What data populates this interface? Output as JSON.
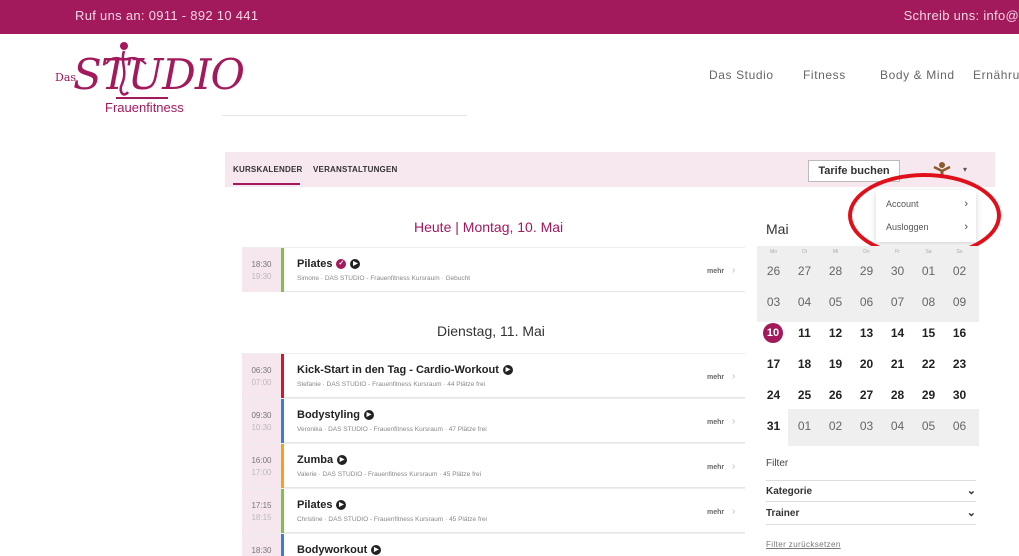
{
  "topbar": {
    "phone": "Ruf uns an: 0911 - 892 10 441",
    "email": "Schreib uns: info@",
    "bg_color": "#a2195c"
  },
  "logo": {
    "das": "Das",
    "studio": "STUDIO",
    "subtitle": "Frauenfitness"
  },
  "nav": {
    "items": [
      "Das Studio",
      "Fitness",
      "Body & Mind",
      "Ernähru"
    ]
  },
  "tabs": {
    "kurskalender": "KURSKALENDER",
    "veranstaltungen": "VERANSTALTUNGEN",
    "tarife_button": "Tarife buchen",
    "avatar_icon": "user-avatar-icon"
  },
  "user_menu": {
    "items": [
      {
        "label": "Account"
      },
      {
        "label": "Ausloggen"
      }
    ]
  },
  "days": [
    {
      "prefix": "Heute",
      "separator": "|",
      "label": "Montag, 10. Mai"
    },
    {
      "label": "Dienstag, 11. Mai"
    }
  ],
  "courses": [
    {
      "start": "18:30",
      "end": "19:30",
      "name": "Pilates",
      "info": "Simone · DAS STUDIO - Frauenfitness Kursraum · Gebucht",
      "color": "#7cc243",
      "booked": true,
      "more": "mehr"
    },
    {
      "start": "06:30",
      "end": "07:00",
      "name": "Kick-Start in den Tag - Cardio-Workout",
      "info": "Stefanie · DAS STUDIO - Frauenfitness Kursraum · 44 Plätze frei",
      "color": "#d8142a",
      "booked": false,
      "more": "mehr"
    },
    {
      "start": "09:30",
      "end": "10:30",
      "name": "Bodystyling",
      "info": "Veronika · DAS STUDIO - Frauenfitness Kursraum · 47 Plätze frei",
      "color": "#3b7dd8",
      "booked": false,
      "more": "mehr"
    },
    {
      "start": "16:00",
      "end": "17:00",
      "name": "Zumba",
      "info": "Valerie · DAS STUDIO - Frauenfitness Kursraum · 45 Plätze frei",
      "color": "#f4a21b",
      "booked": false,
      "more": "mehr"
    },
    {
      "start": "17:15",
      "end": "18:15",
      "name": "Pilates",
      "info": "Christine · DAS STUDIO - Frauenfitness Kursraum · 45 Plätze frei",
      "color": "#7cc243",
      "booked": false,
      "more": "mehr"
    },
    {
      "start": "18:30",
      "end": "",
      "name": "Bodyworkout",
      "info": "",
      "color": "#3b7dd8",
      "booked": false,
      "more": ""
    }
  ],
  "calendar": {
    "month": "Mai",
    "weekdays": [
      "Mo",
      "Di",
      "Mi",
      "Do",
      "Fr",
      "Sa",
      "So"
    ],
    "weeks": [
      [
        "26",
        "27",
        "28",
        "29",
        "30",
        "01",
        "02"
      ],
      [
        "03",
        "04",
        "05",
        "06",
        "07",
        "08",
        "09"
      ],
      [
        "10",
        "11",
        "12",
        "13",
        "14",
        "15",
        "16"
      ],
      [
        "17",
        "18",
        "19",
        "20",
        "21",
        "22",
        "23"
      ],
      [
        "24",
        "25",
        "26",
        "27",
        "28",
        "29",
        "30"
      ],
      [
        "31",
        "01",
        "02",
        "03",
        "04",
        "05",
        "06"
      ]
    ],
    "today": "10"
  },
  "filter": {
    "title": "Filter",
    "kategorie": "Kategorie",
    "trainer": "Trainer",
    "reset": "Filter zurücksetzen"
  }
}
